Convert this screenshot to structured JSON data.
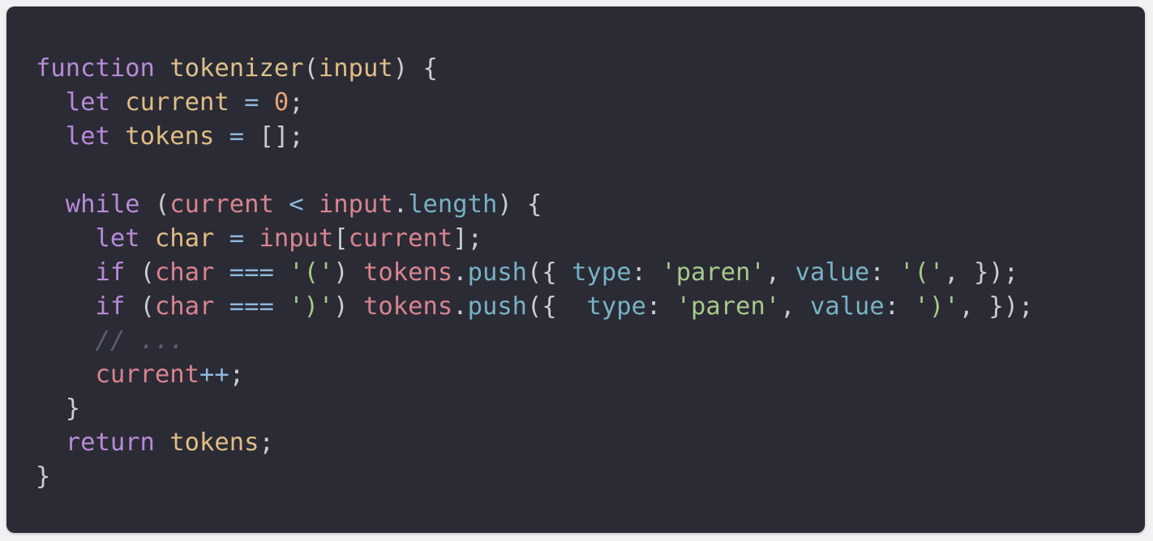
{
  "colors": {
    "background": "#2b2b35",
    "keyword": "#b88ad8",
    "function_name": "#dcc08a",
    "variable": "#e0bd84",
    "param": "#e0bd84",
    "local": "#d8848e",
    "number": "#e7a274",
    "string": "#a6c98a",
    "property": "#77b2c4",
    "punctuation": "#c9ccd3",
    "operator": "#8fb8dc",
    "comment": "#5b5f6d"
  },
  "code": {
    "language": "javascript",
    "lines": [
      [
        {
          "t": "function",
          "k": "keyword"
        },
        {
          "t": " ",
          "k": "punctuation"
        },
        {
          "t": "tokenizer",
          "k": "function_name"
        },
        {
          "t": "(",
          "k": "punctuation"
        },
        {
          "t": "input",
          "k": "param"
        },
        {
          "t": ") {",
          "k": "punctuation"
        }
      ],
      [
        {
          "t": "  ",
          "k": "punctuation"
        },
        {
          "t": "let",
          "k": "keyword"
        },
        {
          "t": " ",
          "k": "punctuation"
        },
        {
          "t": "current",
          "k": "variable"
        },
        {
          "t": " = ",
          "k": "operator"
        },
        {
          "t": "0",
          "k": "number"
        },
        {
          "t": ";",
          "k": "punctuation"
        }
      ],
      [
        {
          "t": "  ",
          "k": "punctuation"
        },
        {
          "t": "let",
          "k": "keyword"
        },
        {
          "t": " ",
          "k": "punctuation"
        },
        {
          "t": "tokens",
          "k": "variable"
        },
        {
          "t": " = ",
          "k": "operator"
        },
        {
          "t": "[];",
          "k": "punctuation"
        }
      ],
      [],
      [
        {
          "t": "  ",
          "k": "punctuation"
        },
        {
          "t": "while",
          "k": "keyword"
        },
        {
          "t": " (",
          "k": "punctuation"
        },
        {
          "t": "current",
          "k": "local"
        },
        {
          "t": " < ",
          "k": "operator"
        },
        {
          "t": "input",
          "k": "local"
        },
        {
          "t": ".",
          "k": "punctuation"
        },
        {
          "t": "length",
          "k": "property"
        },
        {
          "t": ") {",
          "k": "punctuation"
        }
      ],
      [
        {
          "t": "    ",
          "k": "punctuation"
        },
        {
          "t": "let",
          "k": "keyword"
        },
        {
          "t": " ",
          "k": "punctuation"
        },
        {
          "t": "char",
          "k": "variable"
        },
        {
          "t": " = ",
          "k": "operator"
        },
        {
          "t": "input",
          "k": "local"
        },
        {
          "t": "[",
          "k": "punctuation"
        },
        {
          "t": "current",
          "k": "local"
        },
        {
          "t": "];",
          "k": "punctuation"
        }
      ],
      [
        {
          "t": "    ",
          "k": "punctuation"
        },
        {
          "t": "if",
          "k": "keyword"
        },
        {
          "t": " (",
          "k": "punctuation"
        },
        {
          "t": "char",
          "k": "local"
        },
        {
          "t": " === ",
          "k": "operator"
        },
        {
          "t": "'('",
          "k": "string"
        },
        {
          "t": ") ",
          "k": "punctuation"
        },
        {
          "t": "tokens",
          "k": "local"
        },
        {
          "t": ".",
          "k": "punctuation"
        },
        {
          "t": "push",
          "k": "property"
        },
        {
          "t": "({ ",
          "k": "punctuation"
        },
        {
          "t": "type",
          "k": "property"
        },
        {
          "t": ": ",
          "k": "punctuation"
        },
        {
          "t": "'paren'",
          "k": "string"
        },
        {
          "t": ", ",
          "k": "punctuation"
        },
        {
          "t": "value",
          "k": "property"
        },
        {
          "t": ": ",
          "k": "punctuation"
        },
        {
          "t": "'('",
          "k": "string"
        },
        {
          "t": ", });",
          "k": "punctuation"
        }
      ],
      [
        {
          "t": "    ",
          "k": "punctuation"
        },
        {
          "t": "if",
          "k": "keyword"
        },
        {
          "t": " (",
          "k": "punctuation"
        },
        {
          "t": "char",
          "k": "local"
        },
        {
          "t": " === ",
          "k": "operator"
        },
        {
          "t": "')'",
          "k": "string"
        },
        {
          "t": ") ",
          "k": "punctuation"
        },
        {
          "t": "tokens",
          "k": "local"
        },
        {
          "t": ".",
          "k": "punctuation"
        },
        {
          "t": "push",
          "k": "property"
        },
        {
          "t": "({  ",
          "k": "punctuation"
        },
        {
          "t": "type",
          "k": "property"
        },
        {
          "t": ": ",
          "k": "punctuation"
        },
        {
          "t": "'paren'",
          "k": "string"
        },
        {
          "t": ", ",
          "k": "punctuation"
        },
        {
          "t": "value",
          "k": "property"
        },
        {
          "t": ": ",
          "k": "punctuation"
        },
        {
          "t": "')'",
          "k": "string"
        },
        {
          "t": ", });",
          "k": "punctuation"
        }
      ],
      [
        {
          "t": "    ",
          "k": "punctuation"
        },
        {
          "t": "// ...",
          "k": "comment"
        }
      ],
      [
        {
          "t": "    ",
          "k": "punctuation"
        },
        {
          "t": "current",
          "k": "local"
        },
        {
          "t": "++",
          "k": "operator"
        },
        {
          "t": ";",
          "k": "punctuation"
        }
      ],
      [
        {
          "t": "  }",
          "k": "punctuation"
        }
      ],
      [
        {
          "t": "  ",
          "k": "punctuation"
        },
        {
          "t": "return",
          "k": "keyword"
        },
        {
          "t": " ",
          "k": "punctuation"
        },
        {
          "t": "tokens",
          "k": "variable"
        },
        {
          "t": ";",
          "k": "punctuation"
        }
      ],
      [
        {
          "t": "}",
          "k": "punctuation"
        }
      ]
    ]
  }
}
